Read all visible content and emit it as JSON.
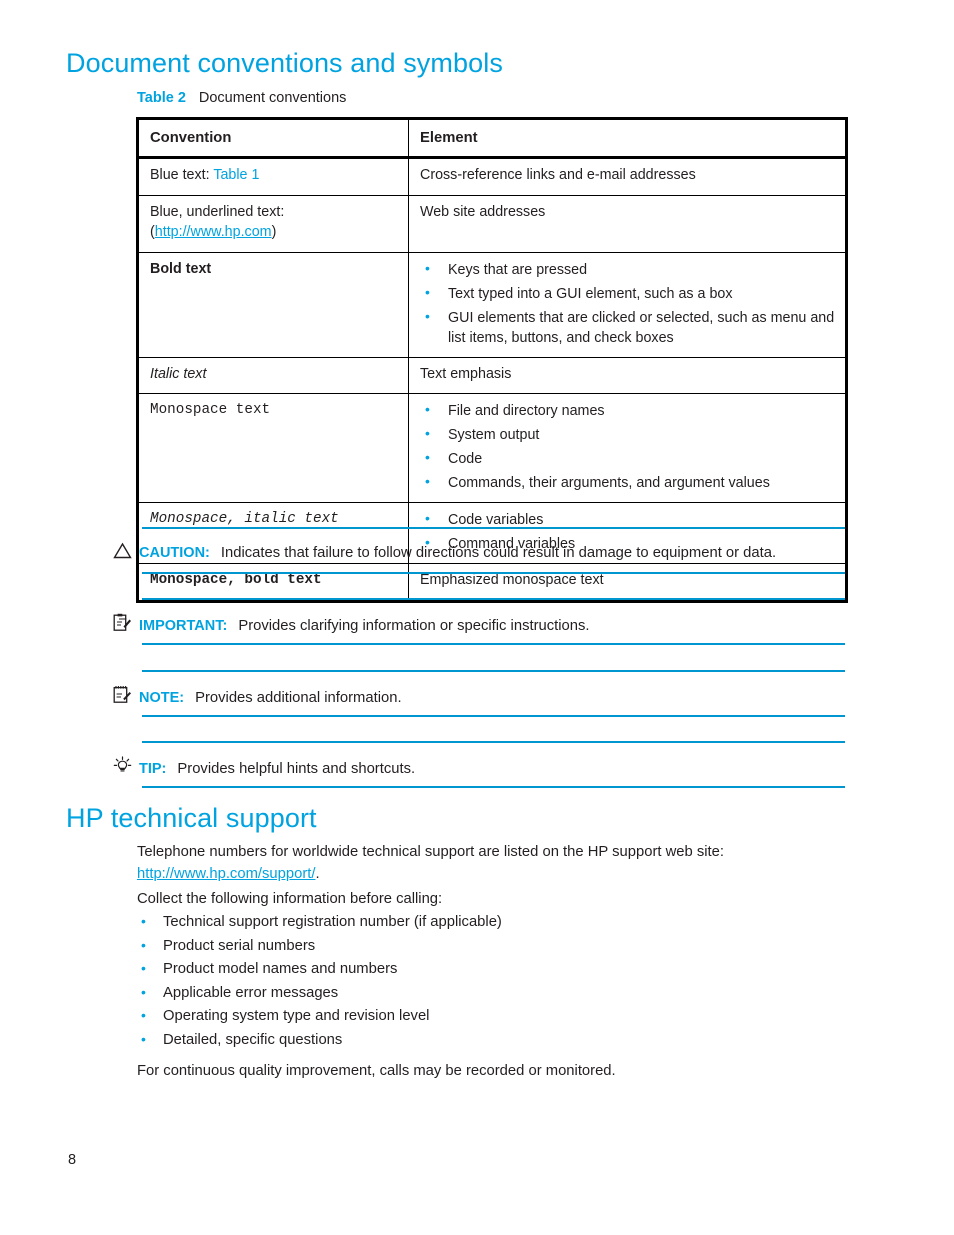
{
  "document": {
    "page_number": "8"
  },
  "sections": {
    "conventions": {
      "heading": "Document conventions and symbols",
      "caption_label": "Table 2",
      "caption_text": "Document conventions"
    },
    "support": {
      "heading": "HP technical support",
      "intro_text": "Telephone numbers for worldwide technical support are listed on the HP support web site:",
      "intro_link": "http://www.hp.com/support/",
      "intro_period": ".",
      "collect_text": "Collect the following information before calling:",
      "items": [
        "Technical support registration number (if applicable)",
        "Product serial numbers",
        "Product model names and numbers",
        "Applicable error messages",
        "Operating system type and revision level",
        "Detailed, specific questions"
      ],
      "footer_text": "For continuous quality improvement, calls may be recorded or monitored."
    }
  },
  "table": {
    "headers": [
      "Convention",
      "Element"
    ],
    "rows": [
      {
        "convention_prefix": "Blue text: ",
        "convention_link": "Table 1",
        "element_text": "Cross-reference links and e-mail addresses"
      },
      {
        "convention_line1": "Blue, underlined text:",
        "convention_paren_open": "(",
        "convention_link": "http://www.hp.com",
        "convention_paren_close": ")",
        "element_text": "Web site addresses"
      },
      {
        "convention_text": "Bold text",
        "element_bullets": [
          "Keys that are pressed",
          "Text typed into a GUI element, such as a box",
          "GUI elements that are clicked or selected, such as menu and list items, buttons, and check boxes"
        ]
      },
      {
        "convention_text": "Italic text",
        "element_text": "Text emphasis"
      },
      {
        "convention_text": "Monospace text",
        "element_bullets": [
          "File and directory names",
          "System output",
          "Code",
          "Commands, their arguments, and argument values"
        ]
      },
      {
        "convention_text": "Monospace, italic text",
        "element_bullets": [
          "Code variables",
          "Command variables"
        ]
      },
      {
        "convention_text": "Monospace, bold text",
        "element_text": "Emphasized monospace text"
      }
    ]
  },
  "notices": [
    {
      "icon": "caution-triangle-icon",
      "label": "CAUTION:",
      "text": "Indicates that failure to follow directions could result in damage to equipment or data."
    },
    {
      "icon": "clipboard-pencil-icon",
      "label": "IMPORTANT:",
      "text": "Provides clarifying information or specific instructions."
    },
    {
      "icon": "notepad-pencil-icon",
      "label": "NOTE:",
      "text": "Provides additional information."
    },
    {
      "icon": "lightbulb-icon",
      "label": "TIP:",
      "text": "Provides helpful hints and shortcuts."
    }
  ],
  "colors": {
    "hp_blue": "#00a3e0",
    "rule_blue": "#0096d0",
    "body_text": "#231f20",
    "table_border": "#000000"
  }
}
